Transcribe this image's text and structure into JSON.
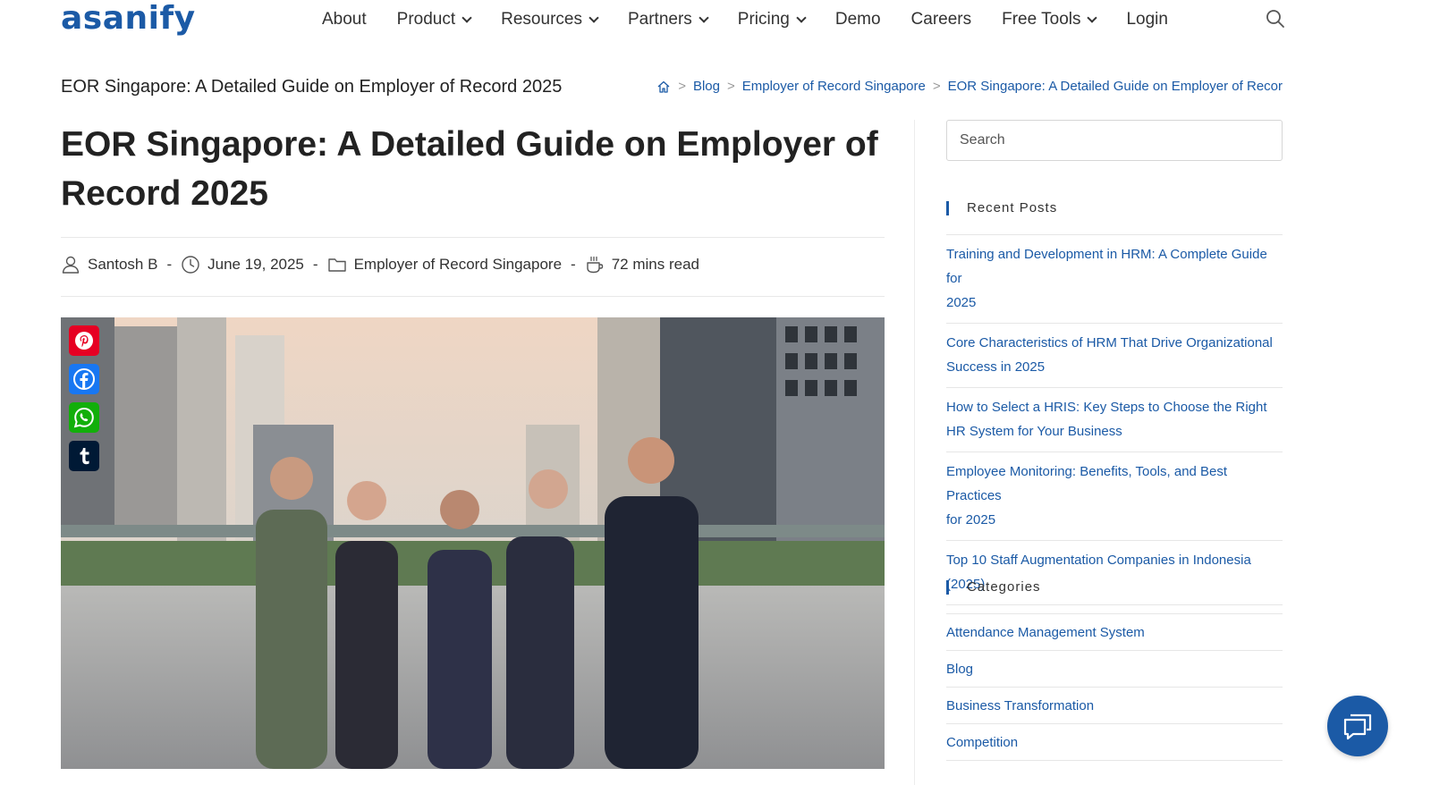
{
  "brand": {
    "logo_text": "asanify",
    "color": "#1b5aa6"
  },
  "nav": {
    "items": [
      {
        "label": "About",
        "dropdown": false
      },
      {
        "label": "Product",
        "dropdown": true
      },
      {
        "label": "Resources",
        "dropdown": true
      },
      {
        "label": "Partners",
        "dropdown": true
      },
      {
        "label": "Pricing",
        "dropdown": true
      },
      {
        "label": "Demo",
        "dropdown": false
      },
      {
        "label": "Careers",
        "dropdown": false
      },
      {
        "label": "Free Tools",
        "dropdown": true
      },
      {
        "label": "Login",
        "dropdown": false
      }
    ],
    "search_icon": "search-icon"
  },
  "page_title": "EOR Singapore: A Detailed Guide on Employer of Record 2025",
  "breadcrumb": {
    "home_icon": "home-icon",
    "items": [
      "Blog",
      "Employer of Record Singapore",
      "EOR Singapore: A Detailed Guide on Employer of Recor"
    ],
    "separator": ">"
  },
  "post": {
    "title": "EOR Singapore: A Detailed Guide on Employer of Record 2025",
    "author": "Santosh B",
    "date": "June 19, 2025",
    "category": "Employer of Record Singapore",
    "read_time": "72 mins read",
    "separator": "-"
  },
  "share": [
    {
      "name": "Pinterest",
      "color": "#e60023"
    },
    {
      "name": "Facebook",
      "color": "#1877f2"
    },
    {
      "name": "WhatsApp",
      "color": "#12af0a"
    },
    {
      "name": "Tumblr",
      "color": "#001935"
    }
  ],
  "sidebar": {
    "search_placeholder": "Search",
    "recent_title": "Recent Posts",
    "recent_posts": [
      {
        "l1": "Training and Development in HRM: A Complete Guide for",
        "l2": "2025"
      },
      {
        "l1": "Core Characteristics of HRM That Drive Organizational",
        "l2": "Success in 2025"
      },
      {
        "l1": "How to Select a HRIS: Key Steps to Choose the Right",
        "l2": "HR System for Your Business"
      },
      {
        "l1": "Employee Monitoring: Benefits, Tools, and Best Practices",
        "l2": "for 2025"
      },
      {
        "l1": "Top 10 Staff Augmentation Companies in Indonesia",
        "l2": "(2025)"
      }
    ],
    "categories_title": "Categories",
    "categories": [
      "Attendance Management System",
      "Blog",
      "Business Transformation",
      "Competition"
    ]
  },
  "chat_icon": "chat-bubble-icon"
}
